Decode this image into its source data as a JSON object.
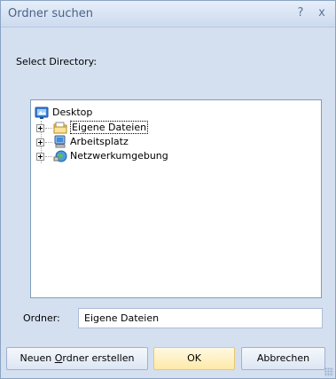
{
  "window": {
    "title": "Ordner suchen",
    "help_glyph": "?",
    "close_glyph": "x"
  },
  "prompt": "Select Directory:",
  "tree": {
    "root": {
      "label": "Desktop",
      "icon": "desktop-icon"
    },
    "children": [
      {
        "label": "Eigene Dateien",
        "icon": "folder-icon",
        "selected": true
      },
      {
        "label": "Arbeitsplatz",
        "icon": "computer-icon",
        "selected": false
      },
      {
        "label": "Netzwerkumgebung",
        "icon": "network-icon",
        "selected": false
      }
    ]
  },
  "folder_field": {
    "label": "Ordner:",
    "value": "Eigene Dateien"
  },
  "buttons": {
    "new_folder_prefix": "Neuen ",
    "new_folder_mnemonic": "O",
    "new_folder_suffix": "rdner erstellen",
    "ok": "OK",
    "cancel": "Abbrechen"
  },
  "colors": {
    "dialog_bg": "#d4e0f0",
    "title_text": "#4a6289",
    "ok_button": "#fde9a7"
  }
}
